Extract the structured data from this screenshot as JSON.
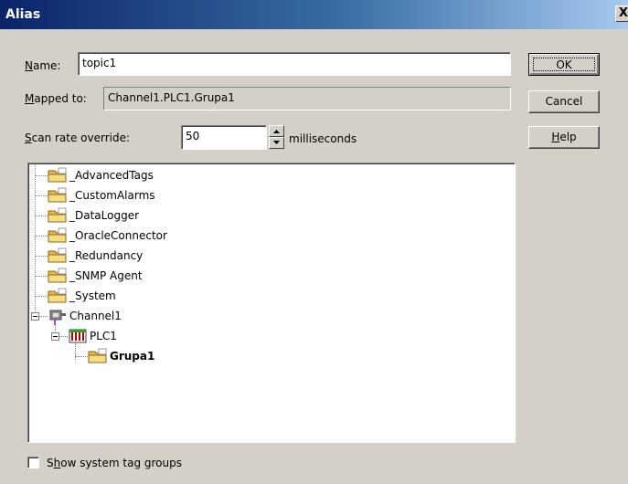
{
  "window": {
    "title": "Alias",
    "close_glyph": "X"
  },
  "form": {
    "name_label": "Name:",
    "name_value": "topic1",
    "mapped_label": "Mapped to:",
    "mapped_value": "Channel1.PLC1.Grupa1",
    "scan_label": "Scan rate override:",
    "scan_value": "50",
    "scan_unit": "milliseconds"
  },
  "buttons": {
    "ok": "OK",
    "cancel": "Cancel",
    "help": "Help"
  },
  "tree": {
    "items": [
      {
        "label": "_AdvancedTags",
        "icon": "folder-icon"
      },
      {
        "label": "_CustomAlarms",
        "icon": "folder-icon"
      },
      {
        "label": "_DataLogger",
        "icon": "folder-icon"
      },
      {
        "label": "_OracleConnector",
        "icon": "folder-icon"
      },
      {
        "label": "_Redundancy",
        "icon": "folder-icon"
      },
      {
        "label": "_SNMP Agent",
        "icon": "folder-icon"
      },
      {
        "label": "_System",
        "icon": "folder-icon"
      },
      {
        "label": "Channel1",
        "icon": "channel-icon"
      },
      {
        "label": "PLC1",
        "icon": "device-icon"
      },
      {
        "label": "Grupa1",
        "icon": "folder-icon",
        "selected": true
      }
    ]
  },
  "footer": {
    "show_system_label": "Show system tag groups",
    "show_system_checked": false
  },
  "colors": {
    "dialog_bg": "#d4d0c8",
    "title_start": "#0a246a",
    "title_end": "#a6caf0",
    "folder": "#f5d67a"
  }
}
